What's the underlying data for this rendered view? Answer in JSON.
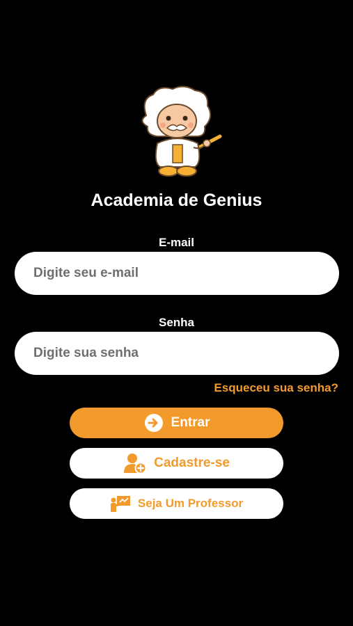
{
  "app": {
    "title": "Academia de Genius",
    "logo_icon": "einstein-mascot-icon"
  },
  "form": {
    "email": {
      "label": "E-mail",
      "placeholder": "Digite seu e-mail",
      "value": ""
    },
    "password": {
      "label": "Senha",
      "placeholder": "Digite sua senha",
      "value": ""
    },
    "forgot_password": "Esqueceu sua senha?"
  },
  "buttons": {
    "login": {
      "label": "Entrar",
      "icon": "login-arrow-icon"
    },
    "register": {
      "label": "Cadastre-se",
      "icon": "add-user-icon"
    },
    "teacher": {
      "label": "Seja Um Professor",
      "icon": "teacher-board-icon"
    }
  },
  "colors": {
    "background": "#000000",
    "accent": "#f39a2c",
    "field_background": "#ffffff"
  }
}
